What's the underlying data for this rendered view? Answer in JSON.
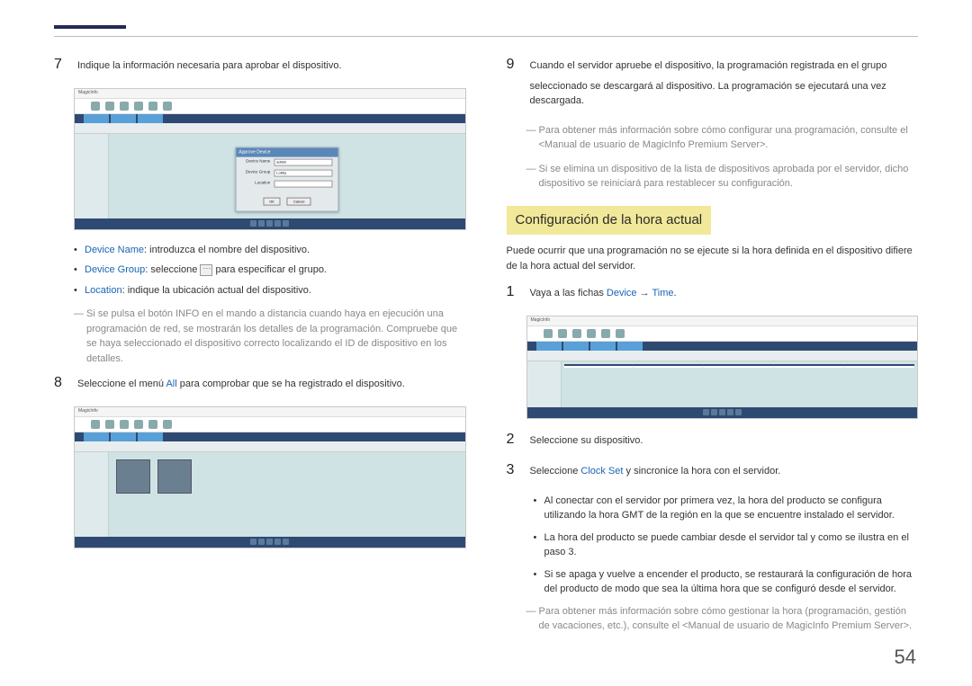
{
  "page_number": "54",
  "left": {
    "step7": {
      "num": "7",
      "text": "Indique la información necesaria para aprobar el dispositivo.",
      "screenshot": {
        "app": "MagicInfo",
        "dialog_title": "Approve Device",
        "field1_label": "Device Name",
        "field1_val": "admin",
        "field2_label": "Device Group",
        "field2_val": "Lobby",
        "field3_label": "Location",
        "field3_val": "",
        "btn_ok": "OK",
        "btn_cancel": "Cancel"
      },
      "bullets": [
        {
          "kw": "Device Name",
          "rest": ": introduzca el nombre del dispositivo."
        },
        {
          "kw": "Device Group",
          "rest_a": ": seleccione ",
          "rest_b": " para especificar el grupo."
        },
        {
          "kw": "Location",
          "rest": ": indique la ubicación actual del dispositivo."
        }
      ],
      "note": "Si se pulsa el botón INFO en el mando a distancia cuando haya en ejecución una programación de red, se mostrarán los detalles de la programación. Compruebe que se haya seleccionado el dispositivo correcto localizando el ID de dispositivo en los detalles."
    },
    "step8": {
      "num": "8",
      "text_a": "Seleccione el menú ",
      "kw": "All",
      "text_b": " para comprobar que se ha registrado el dispositivo.",
      "screenshot": {
        "app": "MagicInfo"
      }
    }
  },
  "right": {
    "step9": {
      "num": "9",
      "p1": "Cuando el servidor apruebe el dispositivo, la programación registrada en el grupo",
      "p2": "seleccionado se descargará al dispositivo. La programación se ejecutará una vez descargada.",
      "note1": "Para obtener más información sobre cómo configurar una programación, consulte el <Manual de usuario de MagicInfo Premium Server>.",
      "note2": "Si se elimina un dispositivo de la lista de dispositivos aprobada por el servidor, dicho dispositivo se reiniciará para restablecer su configuración."
    },
    "section_title": "Configuración de la hora actual",
    "intro": "Puede ocurrir que una programación no se ejecute si la hora definida en el dispositivo difiere de la hora actual del servidor.",
    "step1": {
      "num": "1",
      "text_a": "Vaya a las fichas ",
      "kw1": "Device",
      "arrow": " → ",
      "kw2": "Time",
      "text_b": ".",
      "screenshot": {
        "app": "MagicInfo"
      }
    },
    "step2": {
      "num": "2",
      "text": "Seleccione su dispositivo."
    },
    "step3": {
      "num": "3",
      "text_a": "Seleccione ",
      "kw": "Clock Set",
      "text_b": " y sincronice la hora con el servidor."
    },
    "bullets": [
      "Al conectar con el servidor por primera vez, la hora del producto se configura utilizando la hora GMT de la región en la que se encuentre instalado el servidor.",
      "La hora del producto se puede cambiar desde el servidor tal y como se ilustra en el paso 3.",
      "Si se apaga y vuelve a encender el producto, se restaurará la configuración de hora del producto de modo que sea la última hora que se configuró desde el servidor."
    ],
    "note_final": "Para obtener más información sobre cómo gestionar la hora (programación, gestión de vacaciones, etc.), consulte el <Manual de usuario de MagicInfo Premium Server>."
  }
}
